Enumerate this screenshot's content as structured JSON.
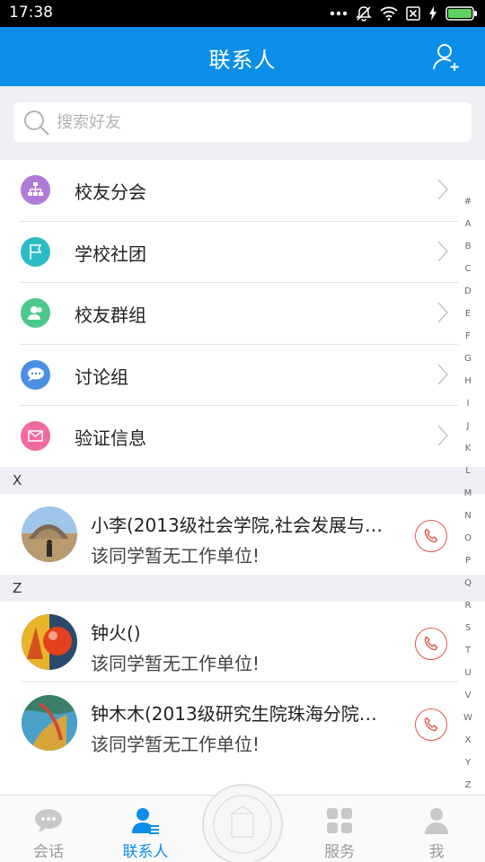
{
  "status_bar": {
    "time": "17:38"
  },
  "header": {
    "title": "联系人"
  },
  "search": {
    "placeholder": "搜索好友"
  },
  "menu": [
    {
      "label": "校友分会",
      "icon": "org-chart-icon",
      "color": "#b07ad6"
    },
    {
      "label": "学校社团",
      "icon": "flag-icon",
      "color": "#2bbcc3"
    },
    {
      "label": "校友群组",
      "icon": "group-icon",
      "color": "#4cc98a"
    },
    {
      "label": "讨论组",
      "icon": "chat-bubble-icon",
      "color": "#4a8fe3"
    },
    {
      "label": "验证信息",
      "icon": "envelope-icon",
      "color": "#ef6aa0"
    }
  ],
  "sections": [
    {
      "letter": "X",
      "contacts": [
        {
          "name": "小李(2013级社会学院,社会发展与…",
          "subtitle": "该同学暂无工作单位!"
        }
      ]
    },
    {
      "letter": "Z",
      "contacts": [
        {
          "name": "钟火()",
          "subtitle": "该同学暂无工作单位!"
        },
        {
          "name": "钟木木(2013级研究生院珠海分院…",
          "subtitle": "该同学暂无工作单位!"
        }
      ]
    }
  ],
  "index_letters": [
    "#",
    "A",
    "B",
    "C",
    "D",
    "E",
    "F",
    "G",
    "H",
    "I",
    "J",
    "K",
    "L",
    "M",
    "N",
    "O",
    "P",
    "Q",
    "R",
    "S",
    "T",
    "U",
    "V",
    "W",
    "X",
    "Y",
    "Z"
  ],
  "bottom_nav": [
    {
      "label": "会话",
      "icon": "chat-icon",
      "active": false
    },
    {
      "label": "联系人",
      "icon": "contacts-icon",
      "active": true
    },
    {
      "label": "服务",
      "icon": "services-grid-icon",
      "active": false
    },
    {
      "label": "我",
      "icon": "profile-icon",
      "active": false
    }
  ],
  "colors": {
    "primary": "#0b8ee7",
    "call_red": "#e0554c"
  }
}
